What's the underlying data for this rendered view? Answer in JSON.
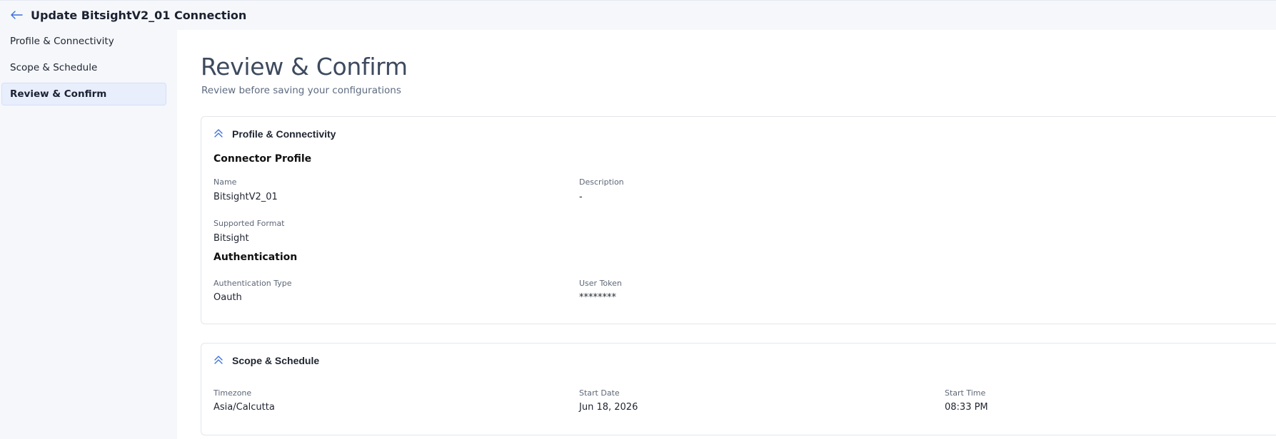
{
  "header": {
    "title": "Update BitsightV2_01 Connection",
    "back_icon": "arrow-left-icon"
  },
  "sidebar": {
    "items": [
      {
        "label": "Profile & Connectivity",
        "active": false
      },
      {
        "label": "Scope & Schedule",
        "active": false
      },
      {
        "label": "Review & Confirm",
        "active": true
      }
    ]
  },
  "main": {
    "title": "Review & Confirm",
    "subtitle": "Review before saving your configurations",
    "profile_card": {
      "title": "Profile & Connectivity",
      "connector_profile": {
        "heading": "Connector Profile",
        "name_label": "Name",
        "name_value": "BitsightV2_01",
        "description_label": "Description",
        "description_value": "-",
        "format_label": "Supported Format",
        "format_value": "Bitsight"
      },
      "authentication": {
        "heading": "Authentication",
        "type_label": "Authentication Type",
        "type_value": "Oauth",
        "token_label": "User Token",
        "token_value": "********"
      }
    },
    "schedule_card": {
      "title": "Scope & Schedule",
      "timezone_label": "Timezone",
      "timezone_value": "Asia/Calcutta",
      "start_date_label": "Start Date",
      "start_date_value": "Jun 18, 2026",
      "start_time_label": "Start Time",
      "start_time_value": "08:33 PM"
    }
  },
  "colors": {
    "accent": "#3b6fd8",
    "sidebar_bg": "#f5f7fb",
    "active_bg": "#e8eefc"
  }
}
